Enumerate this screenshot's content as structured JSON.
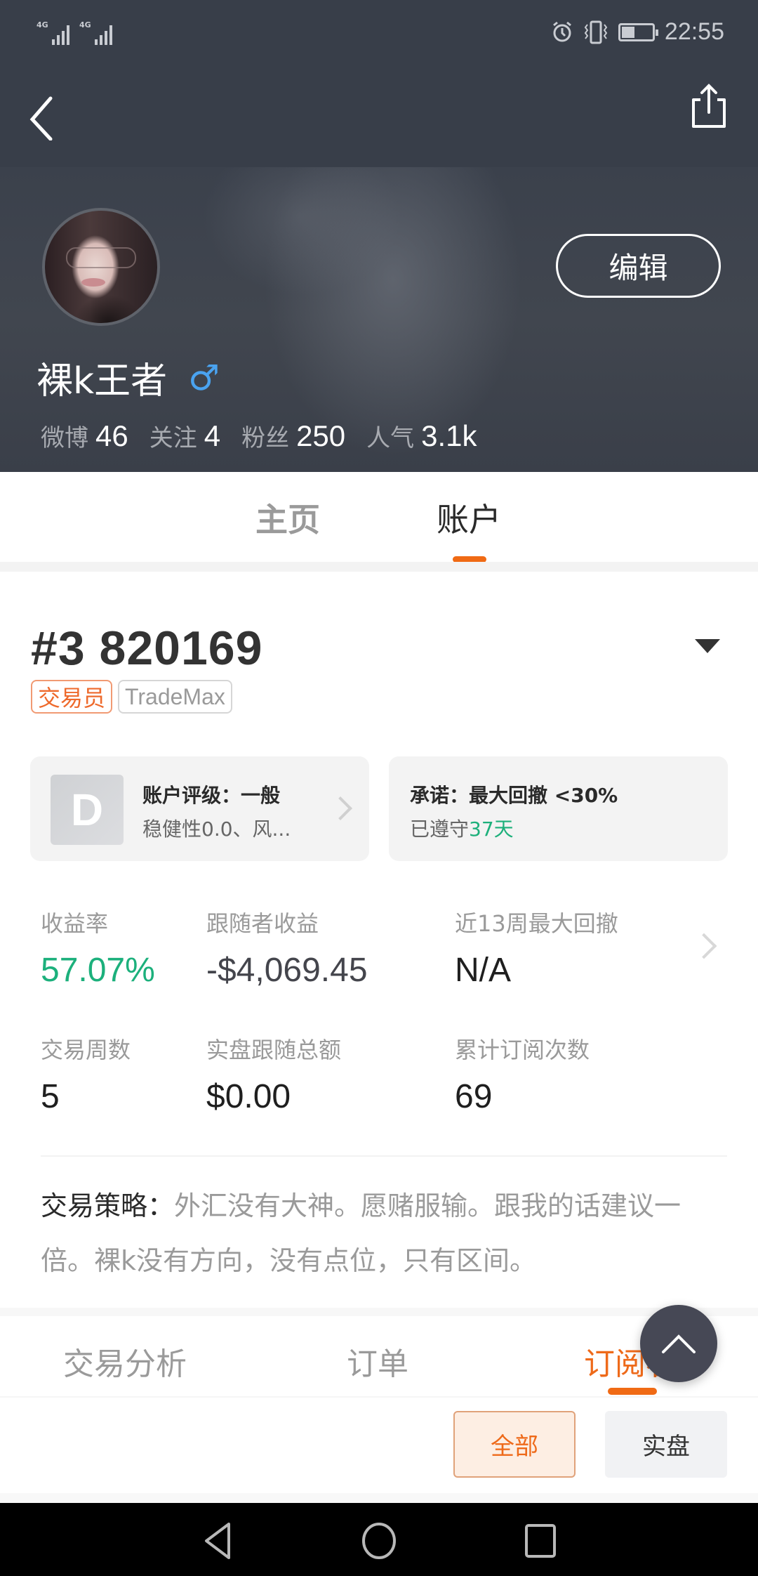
{
  "status_bar": {
    "network_1": "4G",
    "network_2": "4G",
    "time": "22:55",
    "icons": [
      "alarm-icon",
      "vibrate-icon",
      "battery-icon"
    ]
  },
  "header": {
    "back_icon": "chevron-left-icon",
    "share_icon": "share-icon"
  },
  "profile": {
    "username": "裸k王者",
    "gender_symbol": "♂",
    "edit_label": "编辑",
    "stats": [
      {
        "label": "微博",
        "value": "46"
      },
      {
        "label": "关注",
        "value": "4"
      },
      {
        "label": "粉丝",
        "value": "250"
      },
      {
        "label": "人气",
        "value": "3.1k"
      }
    ]
  },
  "main_tabs": [
    {
      "label": "主页",
      "active": false
    },
    {
      "label": "账户",
      "active": true
    }
  ],
  "account": {
    "id": "#3 820169",
    "badges": [
      "交易员",
      "TradeMax"
    ],
    "rating_card": {
      "grade": "D",
      "title": "账户评级：一般",
      "subtitle": "稳健性0.0、风..."
    },
    "promise_card": {
      "title": "承诺：最大回撤 <30%",
      "subtitle_prefix": "已遵守",
      "subtitle_highlight": "37天"
    },
    "metrics": [
      {
        "label": "收益率",
        "value": "57.07%"
      },
      {
        "label": "跟随者收益",
        "value": "-$4,069.45"
      },
      {
        "label": "近13周最大回撤",
        "value": "N/A"
      },
      {
        "label": "交易周数",
        "value": "5"
      },
      {
        "label": "实盘跟随总额",
        "value": "$0.00"
      },
      {
        "label": "累计订阅次数",
        "value": "69"
      }
    ],
    "strategy_label": "交易策略：",
    "strategy_text": "外汇没有大神。愿赌服输。跟我的话建议一倍。裸k没有方向，没有点位，只有区间。"
  },
  "sub_tabs": [
    {
      "label": "交易分析",
      "active": false
    },
    {
      "label": "订单",
      "active": false
    },
    {
      "label": "订阅者",
      "active": true
    }
  ],
  "filters": [
    {
      "label": "全部",
      "active": true
    },
    {
      "label": "实盘",
      "active": false
    }
  ],
  "colors": {
    "accent": "#f06a14",
    "positive": "#1cb07c",
    "header_bg": "#383e49",
    "gender": "#4aa3f0"
  }
}
